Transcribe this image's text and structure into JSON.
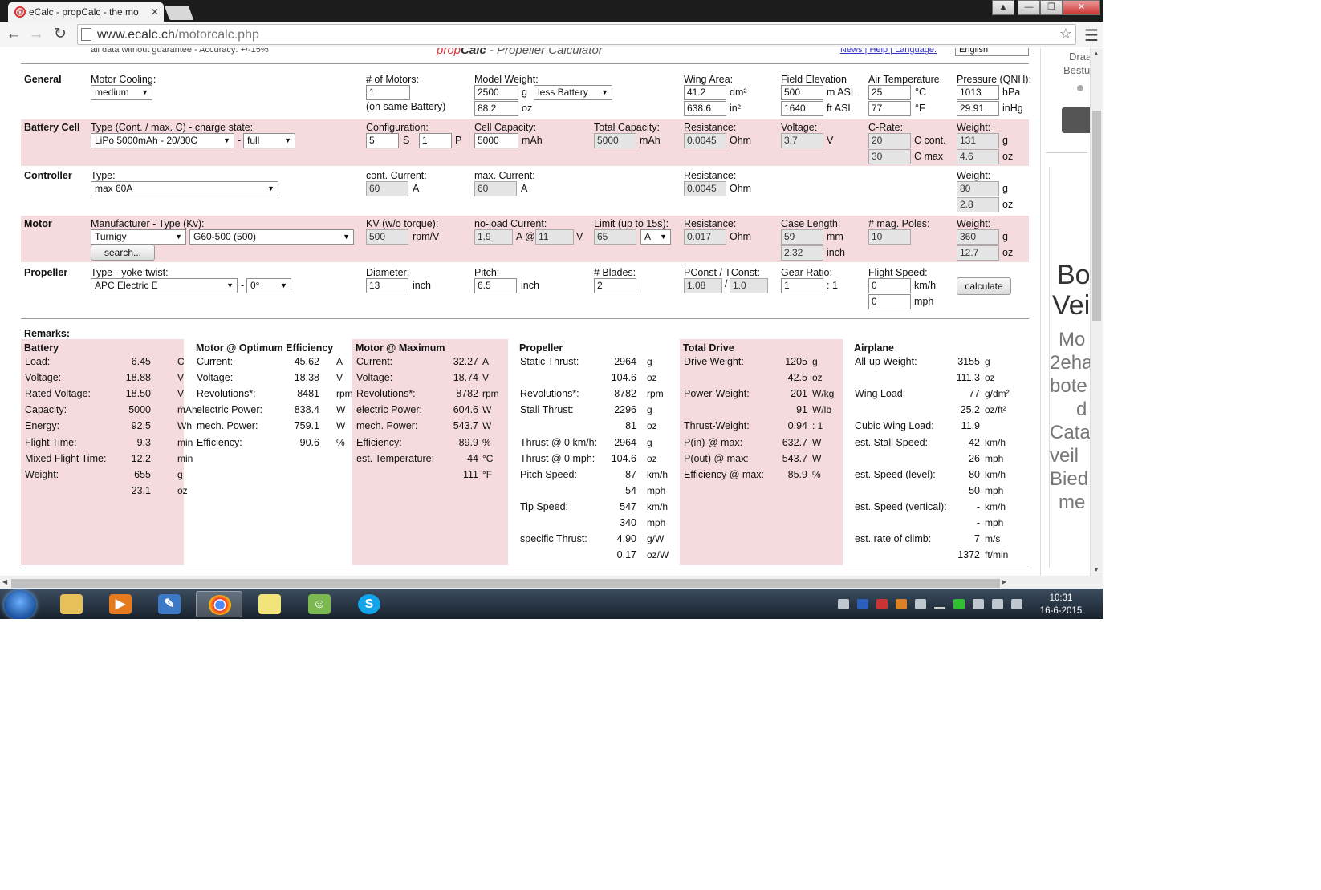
{
  "browser": {
    "tab_title": "eCalc - propCalc - the mo",
    "favicon": "@",
    "tab_close": "✕",
    "url_host": "www.ecalc.ch",
    "url_path": "/motorcalc.php",
    "window_buttons": [
      "▲",
      "—",
      "❐",
      "✕"
    ]
  },
  "header": {
    "disclaimer": "all data without guarantee - Accuracy: +/-15%",
    "brand_prefix": "prop",
    "brand_bold": "Calc",
    "brand_rest": " - Propeller Calculator",
    "links": "News | Help | Language:",
    "language": "English"
  },
  "general": {
    "section": "General",
    "motor_cooling_label": "Motor Cooling:",
    "motor_cooling": "medium",
    "motors_label": "# of Motors:",
    "motors": "1",
    "motors_note": "(on same Battery)",
    "model_weight_label": "Model Weight:",
    "model_weight_g": "2500",
    "model_weight_oz": "88.2",
    "unit_g": "g",
    "unit_oz": "oz",
    "battery_mode": "less Battery",
    "wing_area_label": "Wing Area:",
    "wing_area_dm2": "41.2",
    "wing_area_in2": "638.6",
    "unit_dm2": "dm²",
    "unit_in2": "in²",
    "field_elev_label": "Field Elevation",
    "field_elev_m": "500",
    "field_elev_ft": "1640",
    "unit_masl": "m ASL",
    "unit_ftasl": "ft ASL",
    "air_temp_label": "Air Temperature",
    "air_temp_c": "25",
    "air_temp_f": "77",
    "unit_c": "°C",
    "unit_f": "°F",
    "pressure_label": "Pressure (QNH):",
    "pressure_hpa": "1013",
    "pressure_inhg": "29.91",
    "unit_hpa": "hPa",
    "unit_inhg": "inHg"
  },
  "battery": {
    "section": "Battery Cell",
    "type_label": "Type (Cont. / max. C) - charge state:",
    "type": "LiPo 5000mAh - 20/30C",
    "dash": "-",
    "charge": "full",
    "config_label": "Configuration:",
    "cells_s": "5",
    "cells_p": "1",
    "unit_s": "S",
    "unit_p": "P",
    "cell_cap_label": "Cell Capacity:",
    "cell_cap": "5000",
    "unit_mah": "mAh",
    "total_cap_label": "Total Capacity:",
    "total_cap": "5000",
    "res_label": "Resistance:",
    "res": "0.0045",
    "unit_ohm": "Ohm",
    "volt_label": "Voltage:",
    "volt": "3.7",
    "unit_v": "V",
    "crate_label": "C-Rate:",
    "c_cont": "20",
    "c_max": "30",
    "unit_ccont": "C cont.",
    "unit_cmax": "C max",
    "weight_label": "Weight:",
    "weight_g": "131",
    "weight_oz": "4.6"
  },
  "controller": {
    "section": "Controller",
    "type_label": "Type:",
    "type": "max 60A",
    "cont_label": "cont. Current:",
    "cont": "60",
    "max_label": "max. Current:",
    "max": "60",
    "unit_a": "A",
    "res_label": "Resistance:",
    "res": "0.0045",
    "weight_label": "Weight:",
    "weight_g": "80",
    "weight_oz": "2.8"
  },
  "motor": {
    "section": "Motor",
    "mfr_label": "Manufacturer - Type (Kv):",
    "manufacturer": "Turnigy",
    "type": "G60-500 (500)",
    "search": "search...",
    "kv_label": "KV (w/o torque):",
    "kv": "500",
    "unit_kv": "rpm/V",
    "noload_label": "no-load Current:",
    "noload_a": "1.9",
    "noload_v": "11",
    "at": "A @",
    "limit_label": "Limit (up to 15s):",
    "limit": "65",
    "limit_unit": "A",
    "res_label": "Resistance:",
    "res": "0.017",
    "case_label": "Case Length:",
    "case_mm": "59",
    "case_in": "2.32",
    "unit_mm": "mm",
    "unit_inch": "inch",
    "poles_label": "# mag. Poles:",
    "poles": "10",
    "weight_label": "Weight:",
    "weight_g": "360",
    "weight_oz": "12.7"
  },
  "propeller": {
    "section": "Propeller",
    "type_label": "Type - yoke twist:",
    "type": "APC Electric E",
    "twist": "0°",
    "dia_label": "Diameter:",
    "dia": "13",
    "pitch_label": "Pitch:",
    "pitch": "6.5",
    "blades_label": "# Blades:",
    "blades": "2",
    "pconst_label": "PConst / TConst:",
    "pconst": "1.08",
    "tconst": "1.0",
    "slash": "/",
    "gear_label": "Gear Ratio:",
    "gear": "1",
    "gear_unit": ": 1",
    "speed_label": "Flight Speed:",
    "speed_kmh": "0",
    "speed_mph": "0",
    "unit_kmh": "km/h",
    "unit_mph": "mph",
    "calculate": "calculate"
  },
  "remarks": {
    "title": "Remarks:",
    "columns": [
      {
        "title": "Battery",
        "rows": [
          {
            "l": "Load:",
            "v": "6.45",
            "u": "C"
          },
          {
            "l": "Voltage:",
            "v": "18.88",
            "u": "V"
          },
          {
            "l": "Rated Voltage:",
            "v": "18.50",
            "u": "V"
          },
          {
            "l": "Capacity:",
            "v": "5000",
            "u": "mAh"
          },
          {
            "l": "Energy:",
            "v": "92.5",
            "u": "Wh"
          },
          {
            "l": "Flight Time:",
            "v": "9.3",
            "u": "min"
          },
          {
            "l": "Mixed Flight Time:",
            "v": "12.2",
            "u": "min"
          },
          {
            "l": "Weight:",
            "v": "655",
            "u": "g"
          },
          {
            "l": "",
            "v": "23.1",
            "u": "oz"
          }
        ]
      },
      {
        "title": "Motor @ Optimum Efficiency",
        "rows": [
          {
            "l": "Current:",
            "v": "45.62",
            "u": "A"
          },
          {
            "l": "Voltage:",
            "v": "18.38",
            "u": "V"
          },
          {
            "l": "Revolutions*:",
            "v": "8481",
            "u": "rpm"
          },
          {
            "l": "electric Power:",
            "v": "838.4",
            "u": "W"
          },
          {
            "l": "mech. Power:",
            "v": "759.1",
            "u": "W"
          },
          {
            "l": "Efficiency:",
            "v": "90.6",
            "u": "%"
          }
        ]
      },
      {
        "title": "Motor @ Maximum",
        "rows": [
          {
            "l": "Current:",
            "v": "32.27",
            "u": "A"
          },
          {
            "l": "Voltage:",
            "v": "18.74",
            "u": "V"
          },
          {
            "l": "Revolutions*:",
            "v": "8782",
            "u": "rpm"
          },
          {
            "l": "electric Power:",
            "v": "604.6",
            "u": "W"
          },
          {
            "l": "mech. Power:",
            "v": "543.7",
            "u": "W"
          },
          {
            "l": "Efficiency:",
            "v": "89.9",
            "u": "%"
          },
          {
            "l": "est. Temperature:",
            "v": "44",
            "u": "°C"
          },
          {
            "l": "",
            "v": "111",
            "u": "°F"
          }
        ]
      },
      {
        "title": "Propeller",
        "rows": [
          {
            "l": "Static Thrust:",
            "v": "2964",
            "u": "g"
          },
          {
            "l": "",
            "v": "104.6",
            "u": "oz"
          },
          {
            "l": "Revolutions*:",
            "v": "8782",
            "u": "rpm"
          },
          {
            "l": "Stall Thrust:",
            "v": "2296",
            "u": "g"
          },
          {
            "l": "",
            "v": "81",
            "u": "oz"
          },
          {
            "l": "Thrust @ 0 km/h:",
            "v": "2964",
            "u": "g"
          },
          {
            "l": "Thrust @ 0 mph:",
            "v": "104.6",
            "u": "oz"
          },
          {
            "l": "Pitch Speed:",
            "v": "87",
            "u": "km/h"
          },
          {
            "l": "",
            "v": "54",
            "u": "mph"
          },
          {
            "l": "Tip Speed:",
            "v": "547",
            "u": "km/h"
          },
          {
            "l": "",
            "v": "340",
            "u": "mph"
          },
          {
            "l": "specific Thrust:",
            "v": "4.90",
            "u": "g/W"
          },
          {
            "l": "",
            "v": "0.17",
            "u": "oz/W"
          }
        ]
      },
      {
        "title": "Total Drive",
        "rows": [
          {
            "l": "Drive Weight:",
            "v": "1205",
            "u": "g"
          },
          {
            "l": "",
            "v": "42.5",
            "u": "oz"
          },
          {
            "l": "Power-Weight:",
            "v": "201",
            "u": "W/kg"
          },
          {
            "l": "",
            "v": "91",
            "u": "W/lb"
          },
          {
            "l": "Thrust-Weight:",
            "v": "0.94",
            "u": ": 1"
          },
          {
            "l": "P(in) @ max:",
            "v": "632.7",
            "u": "W"
          },
          {
            "l": "P(out) @ max:",
            "v": "543.7",
            "u": "W"
          },
          {
            "l": "Efficiency @ max:",
            "v": "85.9",
            "u": "%"
          }
        ]
      },
      {
        "title": "Airplane",
        "rows": [
          {
            "l": "All-up Weight:",
            "v": "3155",
            "u": "g"
          },
          {
            "l": "",
            "v": "111.3",
            "u": "oz"
          },
          {
            "l": "Wing Load:",
            "v": "77",
            "u": "g/dm²"
          },
          {
            "l": "",
            "v": "25.2",
            "u": "oz/ft²"
          },
          {
            "l": "Cubic Wing Load:",
            "v": "11.9",
            "u": ""
          },
          {
            "l": "est. Stall Speed:",
            "v": "42",
            "u": "km/h"
          },
          {
            "l": "",
            "v": "26",
            "u": "mph"
          },
          {
            "l": "est. Speed (level):",
            "v": "80",
            "u": "km/h"
          },
          {
            "l": "",
            "v": "50",
            "u": "mph"
          },
          {
            "l": "est. Speed (vertical):",
            "v": "-",
            "u": "km/h"
          },
          {
            "l": "",
            "v": "-",
            "u": "mph"
          },
          {
            "l": "est. rate of climb:",
            "v": "7",
            "u": "m/s"
          },
          {
            "l": "",
            "v": "1372",
            "u": "ft/min"
          }
        ]
      }
    ]
  },
  "side_ad": {
    "top1": "Draa",
    "top2": "Bestu",
    "big1": "Bo",
    "big2": "Vei",
    "lines": [
      "Mo",
      "2eha",
      "bote",
      "d",
      "Cata",
      "veil",
      "Bied",
      "me"
    ]
  },
  "taskbar": {
    "time": "10:31",
    "date": "16-6-2015"
  },
  "colors": {
    "band_pink": "#f5dbdd",
    "brand_red": "#d23a3a"
  }
}
